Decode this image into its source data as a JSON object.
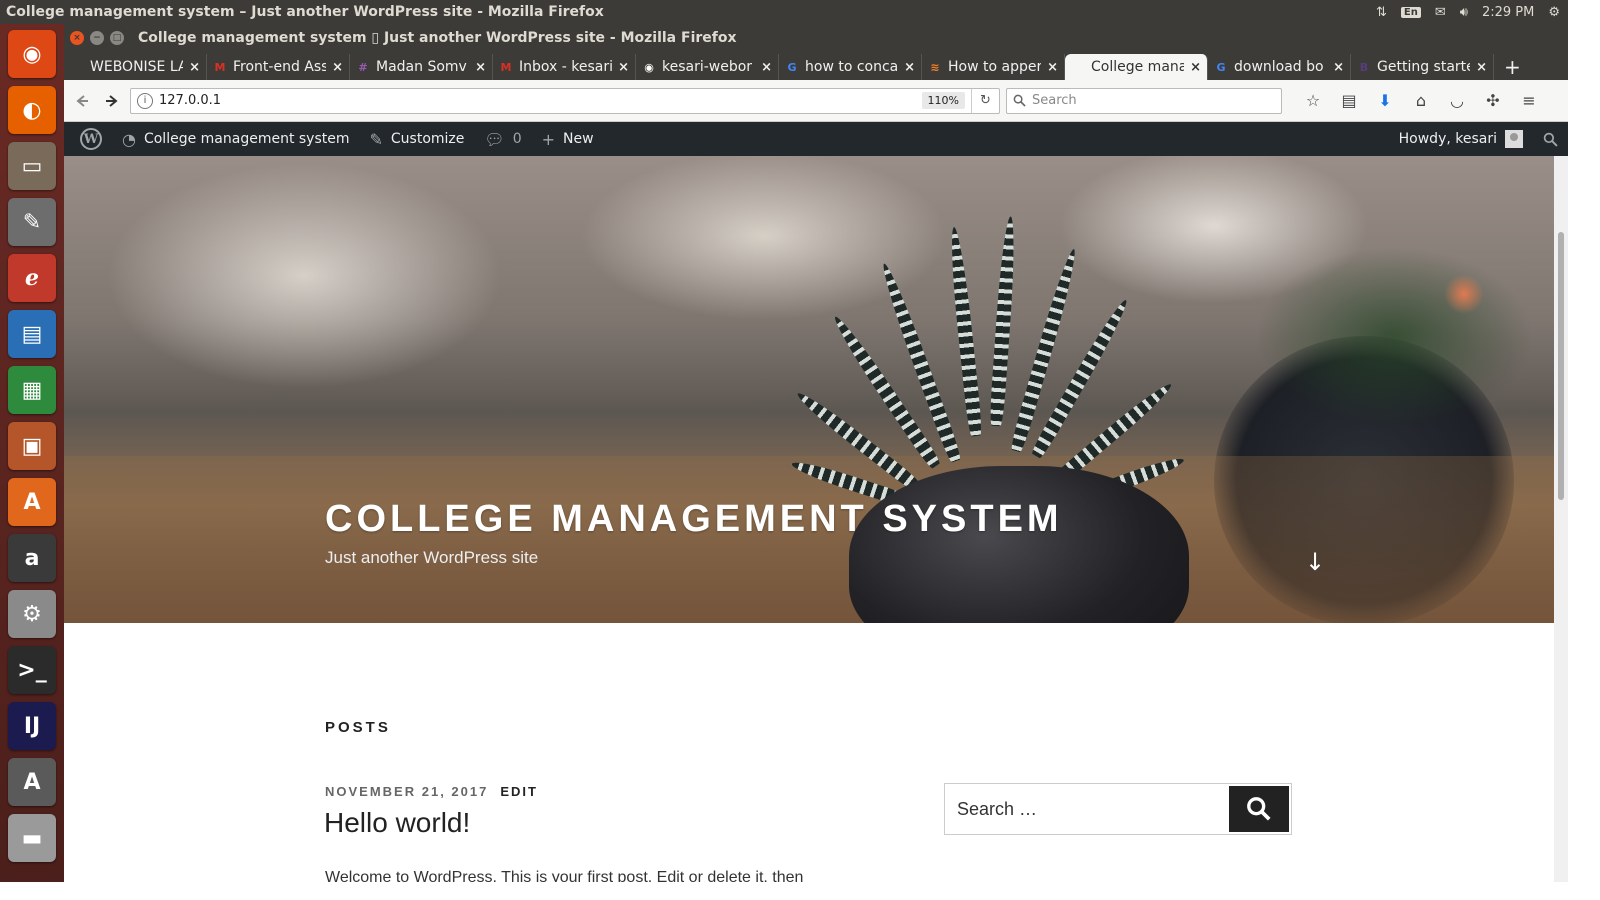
{
  "top_panel": {
    "title": "College management system – Just another WordPress site - Mozilla Firefox",
    "language": "En",
    "clock": "2:29 PM"
  },
  "launcher": {
    "items": [
      {
        "name": "ubuntu-dash-icon",
        "glyph": "◉",
        "color": "#dd4814"
      },
      {
        "name": "firefox-icon",
        "glyph": "◐",
        "color": "#e66000"
      },
      {
        "name": "files-icon",
        "glyph": "▭",
        "color": "#7a6a5a"
      },
      {
        "name": "text-editor-icon",
        "glyph": "✎",
        "color": "#6d6d6d"
      },
      {
        "name": "document-viewer-icon",
        "glyph": "ℯ",
        "color": "#c0392b"
      },
      {
        "name": "writer-icon",
        "glyph": "▤",
        "color": "#2a6fb5"
      },
      {
        "name": "calc-icon",
        "glyph": "▦",
        "color": "#2e8b3d"
      },
      {
        "name": "impress-icon",
        "glyph": "▣",
        "color": "#b5562a"
      },
      {
        "name": "software-center-icon",
        "glyph": "A",
        "color": "#e0671c"
      },
      {
        "name": "amazon-icon",
        "glyph": "a",
        "color": "#3a3a3a"
      },
      {
        "name": "system-settings-icon",
        "glyph": "⚙",
        "color": "#8a8a8a"
      },
      {
        "name": "terminal-icon",
        "glyph": ">_",
        "color": "#2b2b2b"
      },
      {
        "name": "intellij-icon",
        "glyph": "IJ",
        "color": "#1b1b4f"
      },
      {
        "name": "software-updater-icon",
        "glyph": "A",
        "color": "#5a5a5a"
      },
      {
        "name": "disk-icon",
        "glyph": "▬",
        "color": "#9a9a9a"
      }
    ]
  },
  "window": {
    "title": "College management system ▯ Just another WordPress site - Mozilla Firefox"
  },
  "tabs": [
    {
      "label": "WEBONISE LAB",
      "favicon": "",
      "fav_color": "#3c3b37",
      "active": false
    },
    {
      "label": "Front-end Ass",
      "favicon": "M",
      "fav_color": "#d93025",
      "active": false
    },
    {
      "label": "Madan Somv",
      "favicon": "#",
      "fav_color": "#9b59b6",
      "active": false
    },
    {
      "label": "Inbox - kesari",
      "favicon": "M",
      "fav_color": "#d93025",
      "active": false
    },
    {
      "label": "kesari-webor",
      "favicon": "◉",
      "fav_color": "#ffffff",
      "active": false
    },
    {
      "label": "how to conca",
      "favicon": "G",
      "fav_color": "#4285f4",
      "active": false
    },
    {
      "label": "How to apper",
      "favicon": "≋",
      "fav_color": "#f48024",
      "active": false
    },
    {
      "label": "College manager",
      "favicon": "",
      "fav_color": "#333333",
      "active": true
    },
    {
      "label": "download bo",
      "favicon": "G",
      "fav_color": "#4285f4",
      "active": false
    },
    {
      "label": "Getting starte",
      "favicon": "B",
      "fav_color": "#563d7c",
      "active": false
    }
  ],
  "navbar": {
    "url": "127.0.0.1",
    "zoom": "110%",
    "search_placeholder": "Search"
  },
  "adminbar": {
    "site_name": "College management system",
    "customize": "Customize",
    "comments_count": "0",
    "new_label": "New",
    "howdy": "Howdy, kesari"
  },
  "hero": {
    "title": "COLLEGE MANAGEMENT SYSTEM",
    "tagline": "Just another WordPress site"
  },
  "content": {
    "posts_heading": "POSTS",
    "post_date": "NOVEMBER 21, 2017",
    "post_edit": "EDIT",
    "post_title": "Hello world!",
    "post_excerpt": "Welcome to WordPress. This is your first post. Edit or delete it, then",
    "search_placeholder": "Search …"
  }
}
